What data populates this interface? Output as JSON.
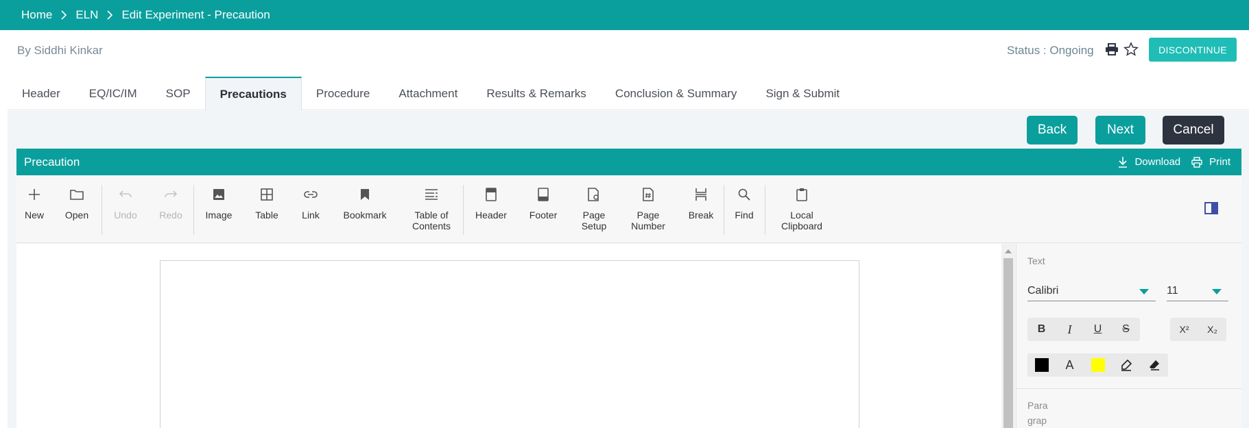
{
  "breadcrumb": {
    "items": [
      "Home",
      "ELN",
      "Edit Experiment - Precaution"
    ]
  },
  "author": "By Siddhi Kinkar",
  "status": "Status : Ongoing",
  "discontinue_label": "DISCONTINUE",
  "tabs": [
    "Header",
    "EQ/IC/IM",
    "SOP",
    "Precautions",
    "Procedure",
    "Attachment",
    "Results & Remarks",
    "Conclusion & Summary",
    "Sign & Submit"
  ],
  "active_tab": "Precautions",
  "actions": {
    "back": "Back",
    "next": "Next",
    "cancel": "Cancel"
  },
  "panel": {
    "title": "Precaution",
    "download": "Download",
    "print": "Print"
  },
  "toolbar": {
    "new": "New",
    "open": "Open",
    "undo": "Undo",
    "redo": "Redo",
    "image": "Image",
    "table": "Table",
    "link": "Link",
    "bookmark": "Bookmark",
    "toc_line1": "Table of",
    "toc_line2": "Contents",
    "header": "Header",
    "footer": "Footer",
    "page_setup_line1": "Page",
    "page_setup_line2": "Setup",
    "page_number_line1": "Page",
    "page_number_line2": "Number",
    "break": "Break",
    "find": "Find",
    "clipboard_line1": "Local",
    "clipboard_line2": "Clipboard"
  },
  "properties": {
    "text_label": "Text",
    "font_family": "Calibri",
    "font_size": "11",
    "bold": "B",
    "italic": "I",
    "underline": "U",
    "strike": "S",
    "superscript": "X²",
    "subscript": "X₂",
    "font_color_glyph": "A",
    "paragraph_label_line1": "Para",
    "paragraph_label_line2": "grap"
  },
  "colors": {
    "teal": "#0a9f9d",
    "discontinue": "#1fbdb6",
    "cancel": "#2d3440",
    "font_color": "#000000",
    "highlight": "#ffff00"
  }
}
